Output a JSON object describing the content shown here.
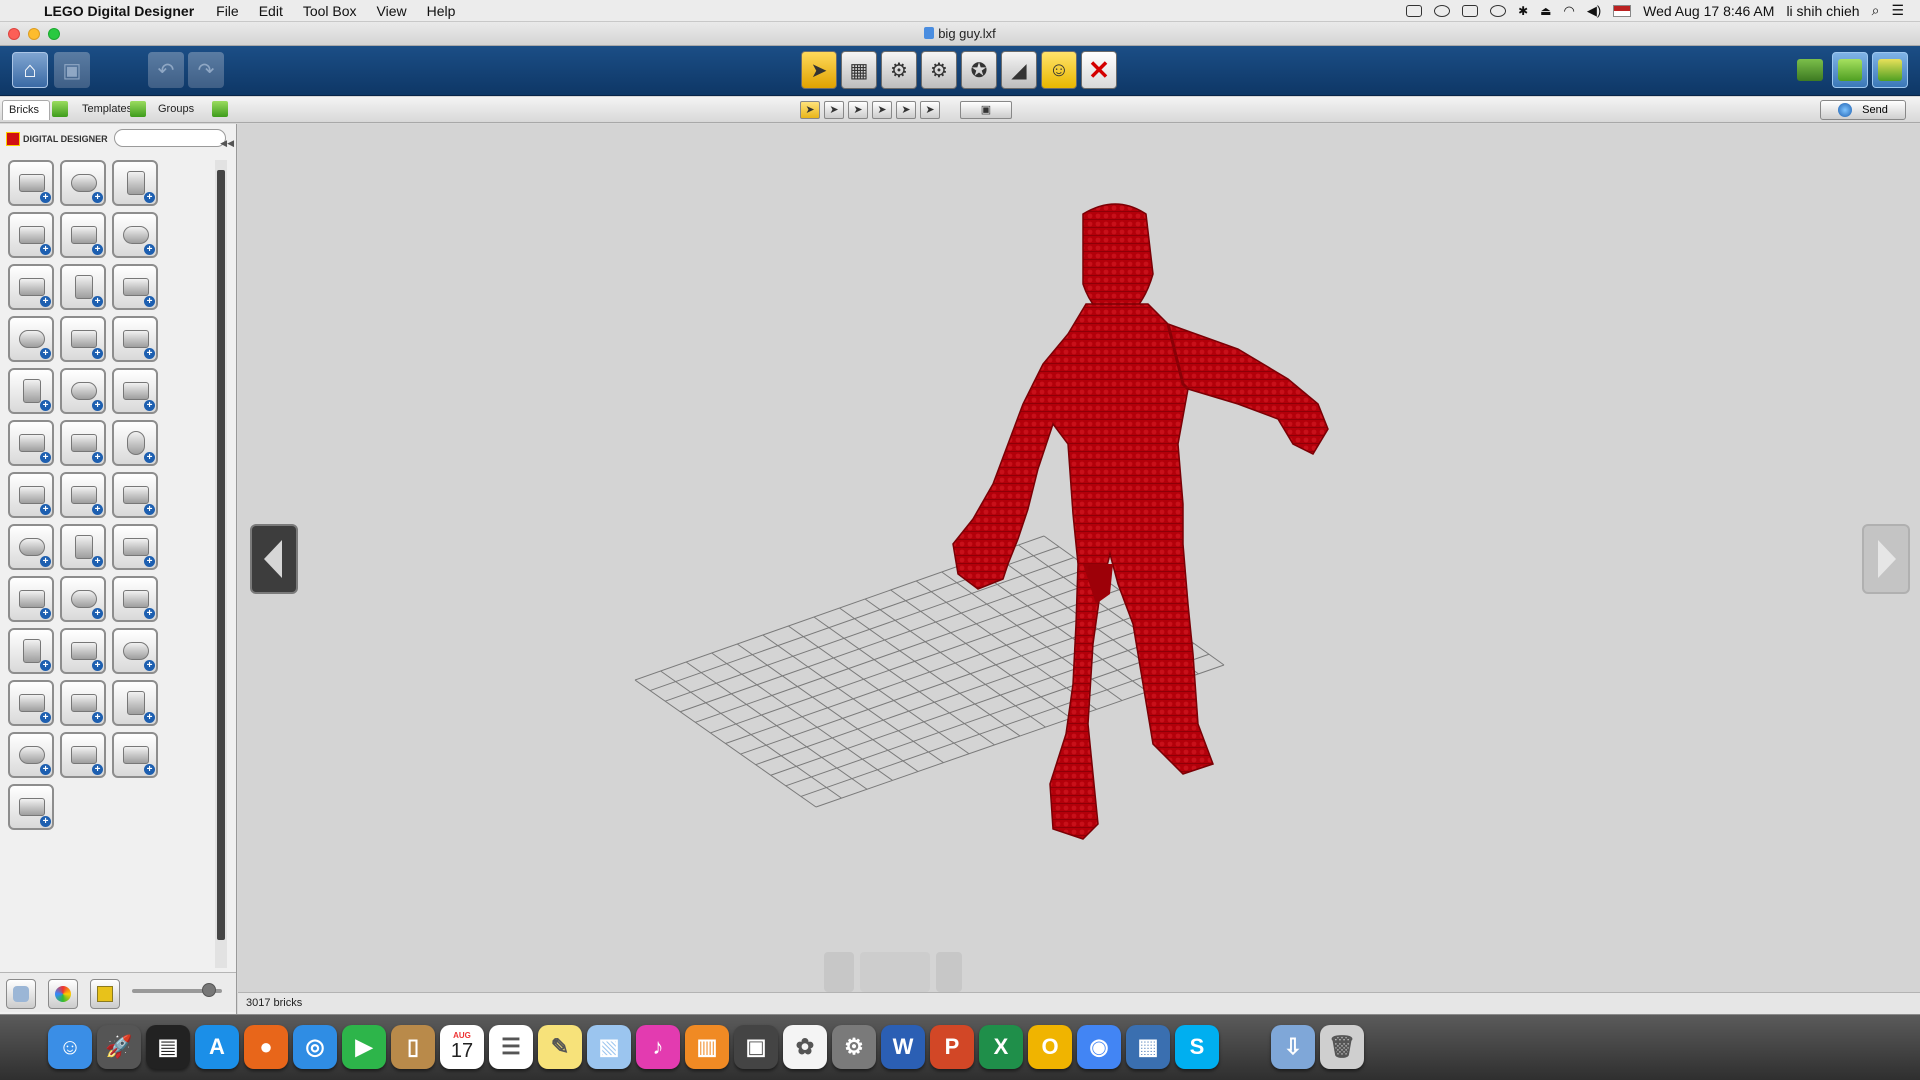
{
  "menubar": {
    "app_name": "LEGO Digital Designer",
    "items": [
      "File",
      "Edit",
      "Tool Box",
      "View",
      "Help"
    ],
    "datetime": "Wed Aug 17  8:46 AM",
    "user": "li shih chieh"
  },
  "window": {
    "title": "big guy.lxf"
  },
  "toolbar": {
    "left_buttons": [
      "home-icon",
      "save-icon",
      "undo-icon",
      "redo-icon"
    ],
    "modes": [
      "select-tool",
      "clone-tool",
      "hinge-tool",
      "hinge-align-tool",
      "flex-tool",
      "paint-tool",
      "hide-tool",
      "delete-tool"
    ],
    "right_buttons": [
      "build-mode-icon",
      "view-mode-icon",
      "building-guide-icon"
    ]
  },
  "subbar": {
    "tabs": [
      "Bricks",
      "Templates",
      "Groups"
    ],
    "send_label": "Send"
  },
  "sidebar": {
    "brand": "DIGITAL DESIGNER",
    "search_placeholder": "",
    "brick_count": 37
  },
  "status": {
    "brick_count_text": "3017 bricks"
  },
  "colors": {
    "model_red": "#b3000a",
    "toolbar_blue": "#144480",
    "viewport_bg": "#d4d4d4"
  },
  "dock": {
    "apps": [
      "Finder",
      "Launchpad",
      "Activity Monitor",
      "App Store",
      "Firefox",
      "Safari",
      "FaceTime",
      "Contacts",
      "Calendar",
      "Reminders",
      "Notes",
      "Preview",
      "iTunes",
      "iBooks",
      "Photo Booth",
      "Photos",
      "System Preferences",
      "Word",
      "PowerPoint",
      "Excel",
      "Outlook",
      "Chrome",
      "Keynote",
      "Skype",
      "Downloads",
      "Trash"
    ],
    "calendar_day": "17",
    "calendar_month": "AUG"
  }
}
